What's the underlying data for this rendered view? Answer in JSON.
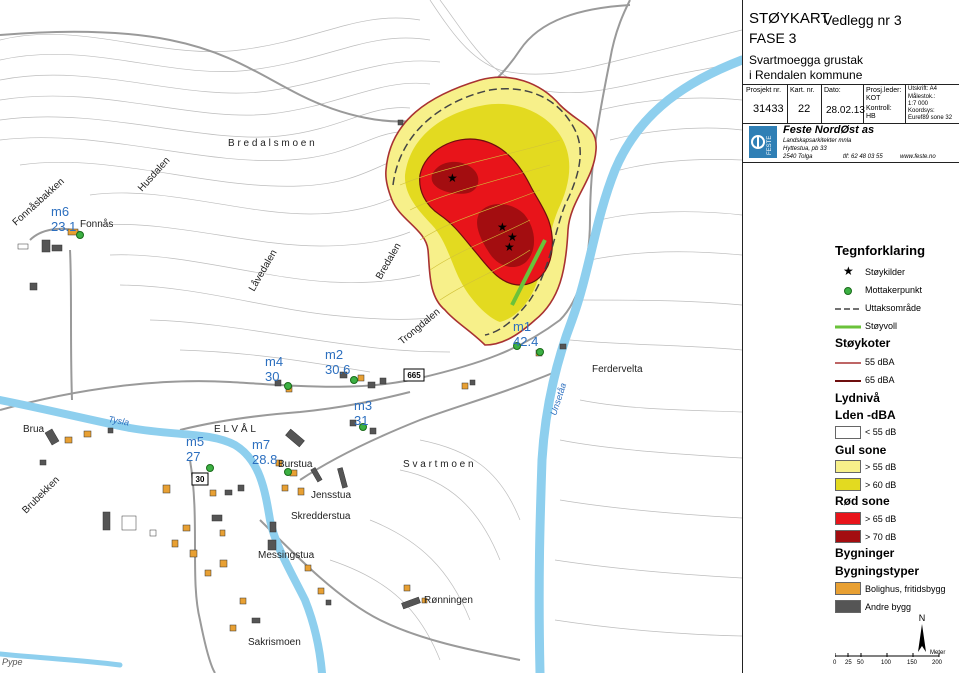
{
  "title_block": {
    "title_line1": "STØYKART",
    "attachment": "Vedlegg nr 3",
    "phase": "FASE 3",
    "project_name": "Svartmoegga grustak",
    "municipality": "i Rendalen kommune",
    "labels": {
      "project_no": "Prosjekt nr.",
      "map_no": "Kart. nr.",
      "date": "Dato:",
      "project_lead": "Prosj.leder:",
      "print": "Utskrift: A4",
      "scale": "Målestok.:",
      "control": "Kontroll:",
      "coords": "Koordsys:"
    },
    "values": {
      "project_no": "31433",
      "map_no": "22",
      "date": "28.02.13",
      "project_lead": "KOT",
      "scale": "1:7 000",
      "control": "HB",
      "coords": "Euref89 sone 32"
    },
    "company": {
      "logo_text": "FESTE",
      "name": "Feste NordØst as",
      "subtitle": "Landskapsarkitekter mnla",
      "address1": "Hyttestua, pb 33",
      "address2": "2540 Tolga",
      "phone": "tlf: 62 48 03 55",
      "web": "www.feste.no"
    }
  },
  "legend": {
    "heading": "Tegnforklaring",
    "items": [
      {
        "label": "Støykilder",
        "symbol": "star"
      },
      {
        "label": "Mottakerpunkt",
        "symbol": "receiver"
      },
      {
        "label": "Uttaksområde",
        "symbol": "dashed"
      },
      {
        "label": "Støyvoll",
        "symbol": "green-line"
      }
    ],
    "contours_heading": "Støykoter",
    "contours": [
      {
        "label": "55 dBA",
        "color": "#a83232"
      },
      {
        "label": "65 dBA",
        "color": "#6e0e0e"
      }
    ],
    "level_heading": "Lydnivå",
    "level_subheading": "Lden -dBA",
    "below": "< 55 dB",
    "yellow_heading": "Gul sone",
    "yellow": [
      {
        "label": "> 55 dB",
        "color": "#f7f08a"
      },
      {
        "label": "> 60 dB",
        "color": "#e3da20"
      }
    ],
    "red_heading": "Rød sone",
    "red": [
      {
        "label": "> 65 dB",
        "color": "#e8141a"
      },
      {
        "label": "> 70 dB",
        "color": "#a30d10"
      }
    ],
    "buildings_heading": "Bygninger",
    "building_types_heading": "Bygningstyper",
    "buildings": [
      {
        "label": "Bolighus, fritidsbygg",
        "color": "#e8a033"
      },
      {
        "label": "Andre bygg",
        "color": "#555555"
      }
    ],
    "north": "N",
    "scale_unit": "Meter",
    "scale_ticks": [
      "0",
      "25",
      "50",
      "100",
      "150",
      "200"
    ]
  },
  "map": {
    "place_names": {
      "bredalsmoen": "B r e d a l s m o e n",
      "husdalen": "Husdalen",
      "fonnasbakken": "Fonnåsbakken",
      "fonnas": "Fonnås",
      "lavedalen": "Låvedalen",
      "bredalen": "Bredalen",
      "trongdalen": "Trongdalen",
      "ferdervelta": "Ferdervelta",
      "unsetaa": "Unsetåa",
      "tysla": "Tysla",
      "brua": "Brua",
      "brubekken": "Brubekken",
      "elval": "E L V Å L",
      "svartmoen": "S v a r t m o e n",
      "burstua": "Burstua",
      "jensstua": "Jensstua",
      "skredderstua": "Skredderstua",
      "messingstua": "Messingstua",
      "ronningen": "Rønningen",
      "sakrismoen": "Sakrismoen",
      "pype": "Pype"
    },
    "road_numbers": {
      "r665": "665",
      "r30": "30"
    },
    "receivers": [
      {
        "id": "m1",
        "value": "42.4"
      },
      {
        "id": "m2",
        "value": "30.6"
      },
      {
        "id": "m3",
        "value": "31"
      },
      {
        "id": "m4",
        "value": "30"
      },
      {
        "id": "m5",
        "value": "27"
      },
      {
        "id": "m6",
        "value": "23.1"
      },
      {
        "id": "m7",
        "value": "28.8"
      }
    ],
    "colors": {
      "river": "#8ecfee",
      "road": "#9a9a9a",
      "contour": "#b8b8b8",
      "label_blue": "#2c6fbf"
    }
  }
}
